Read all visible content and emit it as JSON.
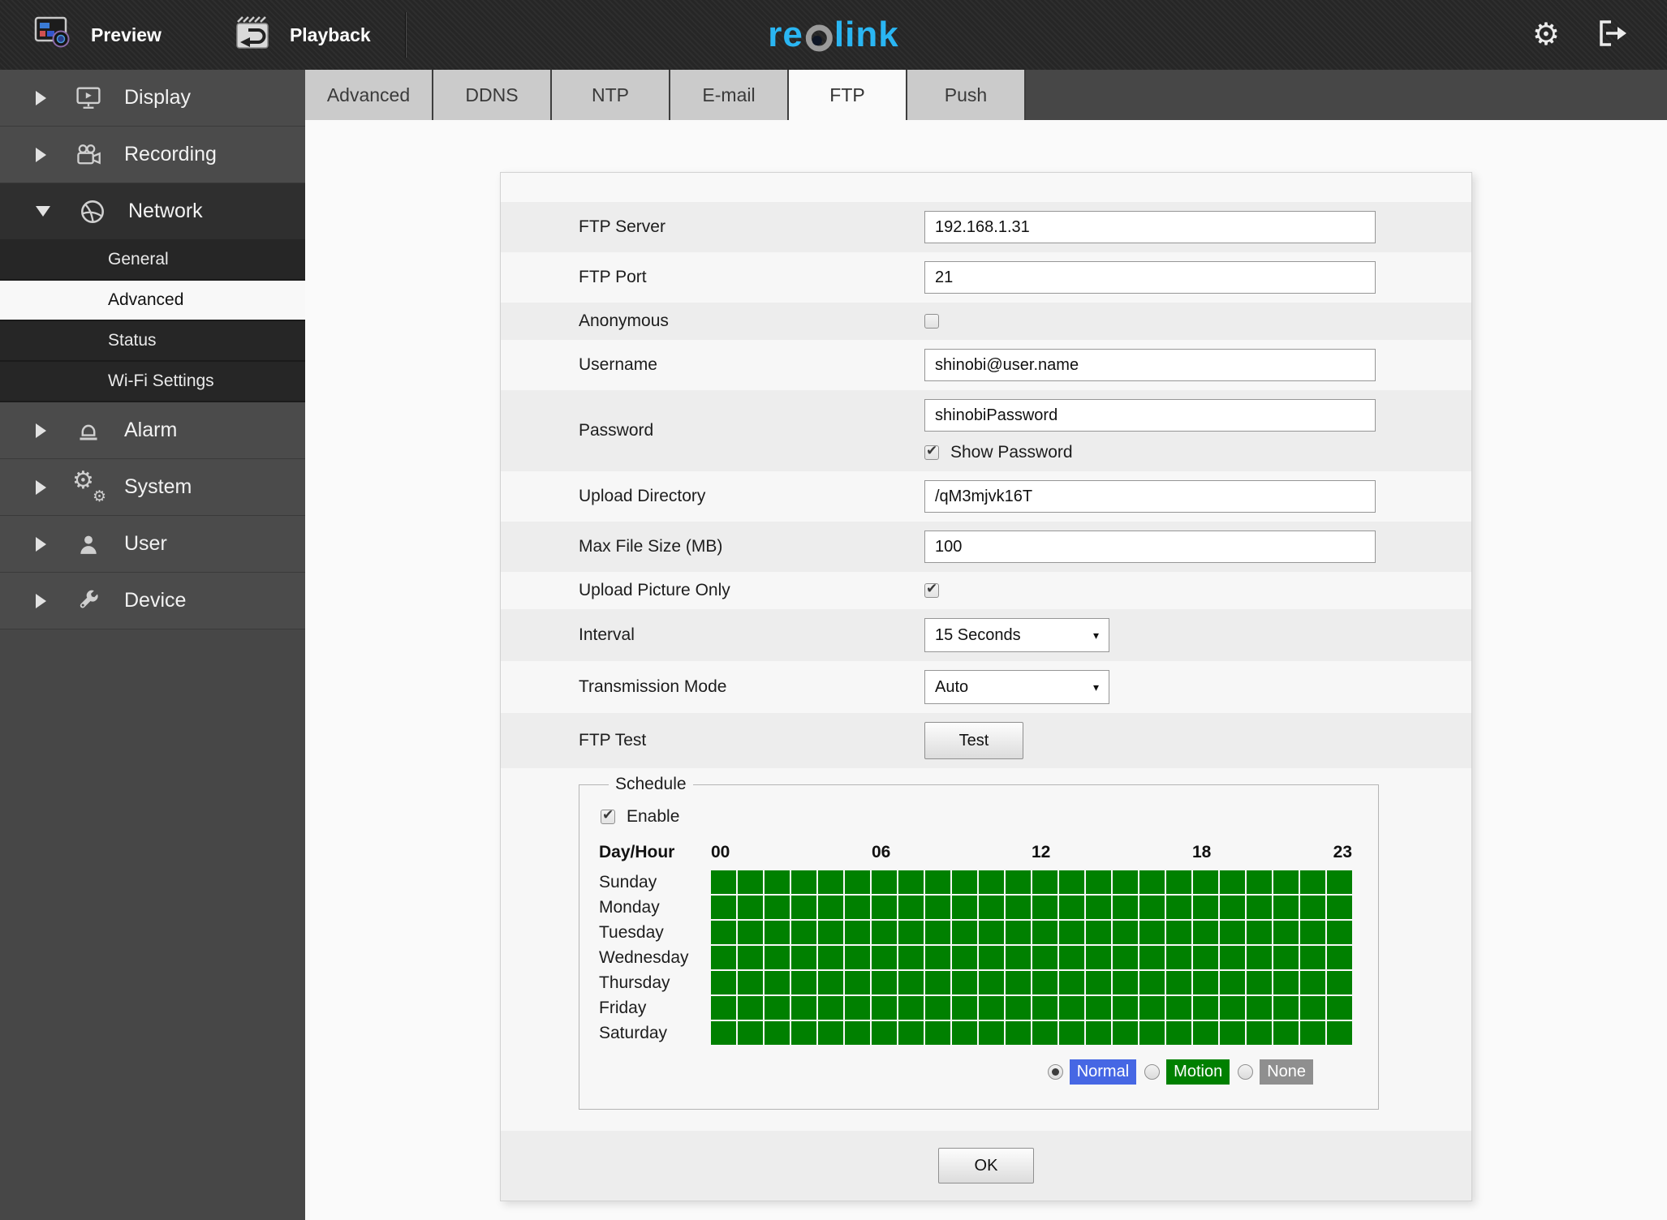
{
  "topbar": {
    "preview_label": "Preview",
    "playback_label": "Playback",
    "brand": {
      "pre": "re",
      "post": "link"
    }
  },
  "icons": {
    "preview-icon": "monitor-with-lens shape",
    "playback-icon": "clapperboard-return-arrow shape",
    "gear-icon": "⚙",
    "logout-icon": "door-exit-arrow shape",
    "chevron-right-icon": "css triangle",
    "chevron-down-icon": "css triangle",
    "display-icon": "monitor-play shape",
    "recording-icon": "movie-camera shape",
    "network-icon": "globe-ball shape",
    "alarm-icon": "siren shape",
    "system-icon": "⚙⚙",
    "user-icon": "person shape",
    "device-icon": "wrench shape",
    "select_caret": "▾",
    "checkbox_check": "✔"
  },
  "sidebar": {
    "items": [
      {
        "id": "display",
        "label": "Display",
        "icon": "display-icon",
        "expanded": false
      },
      {
        "id": "recording",
        "label": "Recording",
        "icon": "recording-icon",
        "expanded": false
      },
      {
        "id": "network",
        "label": "Network",
        "icon": "network-icon",
        "expanded": true,
        "children": [
          {
            "id": "general",
            "label": "General",
            "active": false
          },
          {
            "id": "advanced",
            "label": "Advanced",
            "active": true
          },
          {
            "id": "status",
            "label": "Status",
            "active": false
          },
          {
            "id": "wifi",
            "label": "Wi-Fi Settings",
            "active": false
          }
        ]
      },
      {
        "id": "alarm",
        "label": "Alarm",
        "icon": "alarm-icon",
        "expanded": false
      },
      {
        "id": "system",
        "label": "System",
        "icon": "system-icon",
        "expanded": false
      },
      {
        "id": "user",
        "label": "User",
        "icon": "user-icon",
        "expanded": false
      },
      {
        "id": "device",
        "label": "Device",
        "icon": "device-icon",
        "expanded": false
      }
    ]
  },
  "tabs": {
    "items": [
      {
        "id": "advanced",
        "label": "Advanced",
        "active": false
      },
      {
        "id": "ddns",
        "label": "DDNS",
        "active": false
      },
      {
        "id": "ntp",
        "label": "NTP",
        "active": false
      },
      {
        "id": "email",
        "label": "E-mail",
        "active": false
      },
      {
        "id": "ftp",
        "label": "FTP",
        "active": true
      },
      {
        "id": "push",
        "label": "Push",
        "active": false
      }
    ]
  },
  "panel": {
    "rows": [
      {
        "id": "ftp-server",
        "label": "FTP Server",
        "type": "text",
        "value": "192.168.1.31"
      },
      {
        "id": "ftp-port",
        "label": "FTP Port",
        "type": "text",
        "value": "21"
      },
      {
        "id": "anonymous",
        "label": "Anonymous",
        "type": "checkbox",
        "checked": false
      },
      {
        "id": "username",
        "label": "Username",
        "type": "text",
        "value": "shinobi@user.name"
      },
      {
        "id": "password",
        "label": "Password",
        "type": "password-group",
        "value": "shinobiPassword",
        "checkbox_label": "Show Password",
        "checked": true
      },
      {
        "id": "upload-directory",
        "label": "Upload Directory",
        "type": "text",
        "value": "/qM3mjvk16T"
      },
      {
        "id": "max-file-size",
        "label": "Max File Size (MB)",
        "type": "text",
        "value": "100"
      },
      {
        "id": "upload-picture-only",
        "label": "Upload Picture Only",
        "type": "checkbox",
        "checked": true
      },
      {
        "id": "interval",
        "label": "Interval",
        "type": "select",
        "value": "15 Seconds"
      },
      {
        "id": "transmission-mode",
        "label": "Transmission Mode",
        "type": "select",
        "value": "Auto"
      },
      {
        "id": "ftp-test",
        "label": "FTP Test",
        "type": "button",
        "value": "Test"
      }
    ],
    "ok_label": "OK"
  },
  "schedule": {
    "legend": "Schedule",
    "enable_label": "Enable",
    "enable_checked": true,
    "header": "Day/Hour",
    "hour_labels": [
      "00",
      "06",
      "12",
      "18",
      "23"
    ],
    "hours_count": 24,
    "days": [
      "Sunday",
      "Monday",
      "Tuesday",
      "Wednesday",
      "Thursday",
      "Friday",
      "Saturday"
    ],
    "grid": {
      "columns": 24,
      "all_on": true,
      "on_color": "#008000"
    },
    "modes": [
      {
        "id": "normal",
        "label": "Normal",
        "color": "#4667e4",
        "selected": true
      },
      {
        "id": "motion",
        "label": "Motion",
        "color": "#008000",
        "selected": false
      },
      {
        "id": "none",
        "label": "None",
        "color": "#8f8f8f",
        "selected": false
      }
    ]
  },
  "colors": {
    "brand_cyan": "#2ab6f3",
    "schedule_green": "#008000",
    "mode_normal_blue": "#4667e4",
    "mode_none_gray": "#8f8f8f",
    "topbar_dark": "#2b2b2b",
    "sidebar_gray": "#4b4b4b"
  }
}
